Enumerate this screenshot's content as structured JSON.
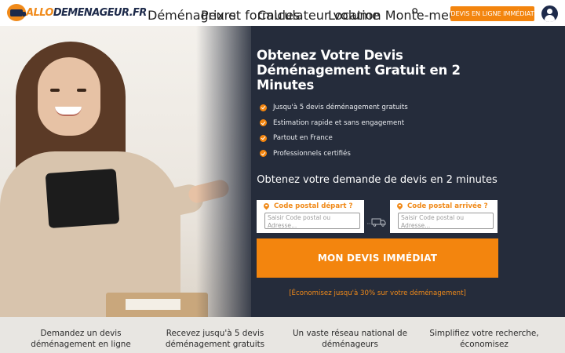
{
  "header": {
    "logo": {
      "part1": "ALLO",
      "part2": "DEMENAGEUR.FR"
    },
    "nav": [
      {
        "label": "Déménageurs"
      },
      {
        "label": "Prix et formules"
      },
      {
        "label": "Calculateur volume"
      },
      {
        "label": "Location Monte-meuble"
      }
    ],
    "cta_label": "DEVIS EN LIGNE IMMÉDIAT",
    "icons": {
      "search": "search-icon",
      "user": "user-icon"
    }
  },
  "hero": {
    "title": "Obtenez Votre Devis Déménagement Gratuit en 2 Minutes",
    "benefits": [
      "Jusqu'à 5 devis déménagement gratuits",
      "Estimation rapide et sans engagement",
      "Partout en France",
      "Professionnels certifiés"
    ]
  },
  "form": {
    "title": "Obtenez votre demande de devis en 2 minutes",
    "departure": {
      "label": "Code postal départ ?",
      "placeholder": "Saisir Code postal ou Adresse..."
    },
    "arrival": {
      "label": "Code postal arrivée ?",
      "placeholder": "Saisir Code postal ou Adresse..."
    },
    "submit_label": "MON DEVIS IMMÉDIAT",
    "savings": "[Économisez jusqu'à 30% sur votre déménagement]"
  },
  "features": [
    "Demandez un devis déménagement en ligne",
    "Recevez jusqu'à 5 devis déménagement gratuits",
    "Un vaste réseau national de déménageurs",
    "Simplifiez votre recherche, économisez"
  ],
  "colors": {
    "accent": "#f3850e",
    "hero_bg": "#252c3b",
    "brand_dark": "#1d2a4a",
    "strip_bg": "#e8e6e2"
  }
}
